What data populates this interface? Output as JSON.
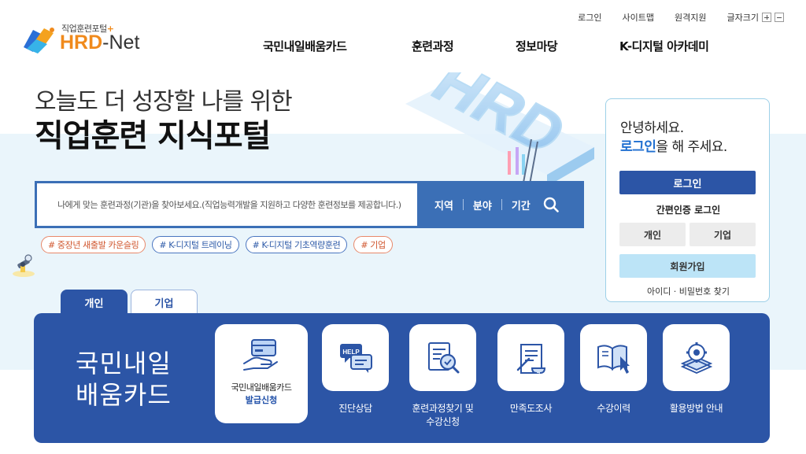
{
  "logo": {
    "sub": "직업훈련포털",
    "brand": "HRD",
    "dash": "-",
    "net": "Net"
  },
  "util": {
    "login": "로그인",
    "sitemap": "사이트맵",
    "remote": "원격지원",
    "fontsize": "글자크기"
  },
  "gnb": [
    "국민내일배움카드",
    "훈련과정",
    "정보마당",
    "K-디지털 아카데미"
  ],
  "hero": {
    "line1": "오늘도 더 성장할 나를 위한",
    "line2": "직업훈련 지식포털"
  },
  "art": {
    "text": "HRD"
  },
  "search": {
    "placeholder": "나에게 맞는 훈련과정(기관)을 찾아보세요.(직업능력개발을 지원하고 다양한 훈련정보를 제공합니다.)",
    "filters": [
      "지역",
      "분야",
      "기간"
    ]
  },
  "tags": [
    {
      "label": "# 중장년 새출발 카운슬링",
      "color": "orange"
    },
    {
      "label": "# K-디지털 트레이닝",
      "color": "blue"
    },
    {
      "label": "# K-디지털 기초역량훈련",
      "color": "blue"
    },
    {
      "label": "# 기업",
      "color": "orange"
    }
  ],
  "login": {
    "greeting": "안녕하세요.",
    "prompt_hl": "로그인",
    "prompt_rest": "을 해 주세요.",
    "button": "로그인",
    "easy": "간편인증 로그인",
    "individual": "개인",
    "business": "기업",
    "join": "회원가입",
    "find": "아이디 · 비밀번호 찾기"
  },
  "tabs": {
    "individual": "개인",
    "business": "기업"
  },
  "panel": {
    "title_line1": "국민내일",
    "title_line2": "배움카드",
    "card_apply_line1": "국민내일배움카드",
    "card_apply_line2": "발급신청",
    "services": [
      {
        "label_line1": "진단상담",
        "label_line2": "",
        "icon": "help-chat-icon"
      },
      {
        "label_line1": "훈련과정찾기 및",
        "label_line2": "수강신청",
        "icon": "document-search-icon"
      },
      {
        "label_line1": "만족도조사",
        "label_line2": "",
        "icon": "survey-scroll-icon"
      },
      {
        "label_line1": "수강이력",
        "label_line2": "",
        "icon": "book-cursor-icon"
      },
      {
        "label_line1": "활용방법 안내",
        "label_line2": "",
        "icon": "gear-stack-icon"
      }
    ]
  },
  "colors": {
    "primary": "#2c55a6",
    "search_blue": "#3b6fb6",
    "brand_orange": "#f08a1c",
    "band": "#eaf5fb",
    "login_highlight": "#1f6fd0",
    "join_bg": "#bce4f7"
  }
}
